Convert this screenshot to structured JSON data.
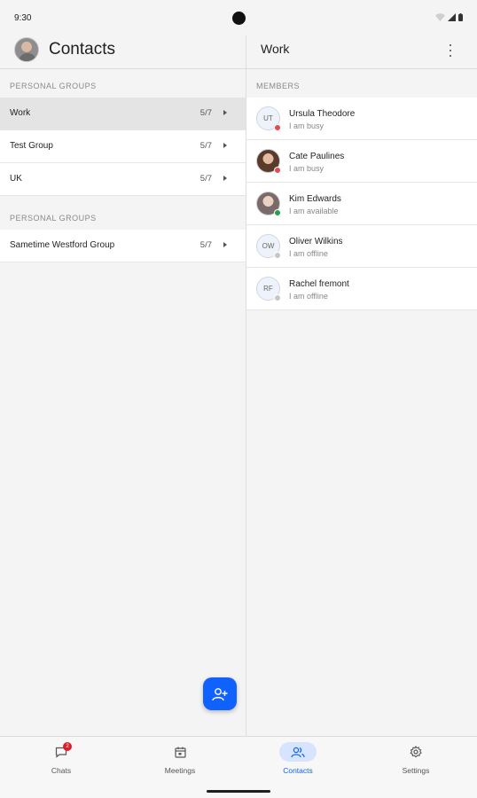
{
  "status_bar": {
    "time": "9:30"
  },
  "left": {
    "title": "Contacts",
    "sections": [
      {
        "label": "PERSONAL GROUPS",
        "groups": [
          {
            "name": "Work",
            "count": "5/7",
            "selected": true
          },
          {
            "name": "Test Group",
            "count": "5/7"
          },
          {
            "name": "UK",
            "count": "5/7"
          }
        ]
      },
      {
        "label": "PERSONAL GROUPS",
        "groups": [
          {
            "name": "Sametime Westford Group",
            "count": "5/7"
          }
        ]
      }
    ],
    "fab_icon": "add-person-icon"
  },
  "right": {
    "title": "Work",
    "members_label": "MEMBERS",
    "members": [
      {
        "initials": "UT",
        "name": "Ursula Theodore",
        "status": "I am busy",
        "presence": "busy",
        "photo": false
      },
      {
        "initials": "",
        "name": "Cate Paulines",
        "status": "I am busy",
        "presence": "busy",
        "photo": true
      },
      {
        "initials": "",
        "name": "Kim Edwards",
        "status": "I am available",
        "presence": "available",
        "photo": true
      },
      {
        "initials": "OW",
        "name": "Oliver Wilkins",
        "status": "I am offline",
        "presence": "offline",
        "photo": false
      },
      {
        "initials": "RF",
        "name": "Rachel fremont",
        "status": "I am offline",
        "presence": "offline",
        "photo": false
      }
    ]
  },
  "presence_colors": {
    "busy": "#e5484d",
    "available": "#24a148",
    "offline": "#c6c6c6"
  },
  "nav": {
    "items": [
      {
        "label": "Chats",
        "icon": "chat-icon",
        "badge": "2"
      },
      {
        "label": "Meetings",
        "icon": "calendar-icon"
      },
      {
        "label": "Contacts",
        "icon": "contacts-icon",
        "active": true
      },
      {
        "label": "Settings",
        "icon": "gear-icon"
      }
    ]
  },
  "accent": "#0f62fe"
}
